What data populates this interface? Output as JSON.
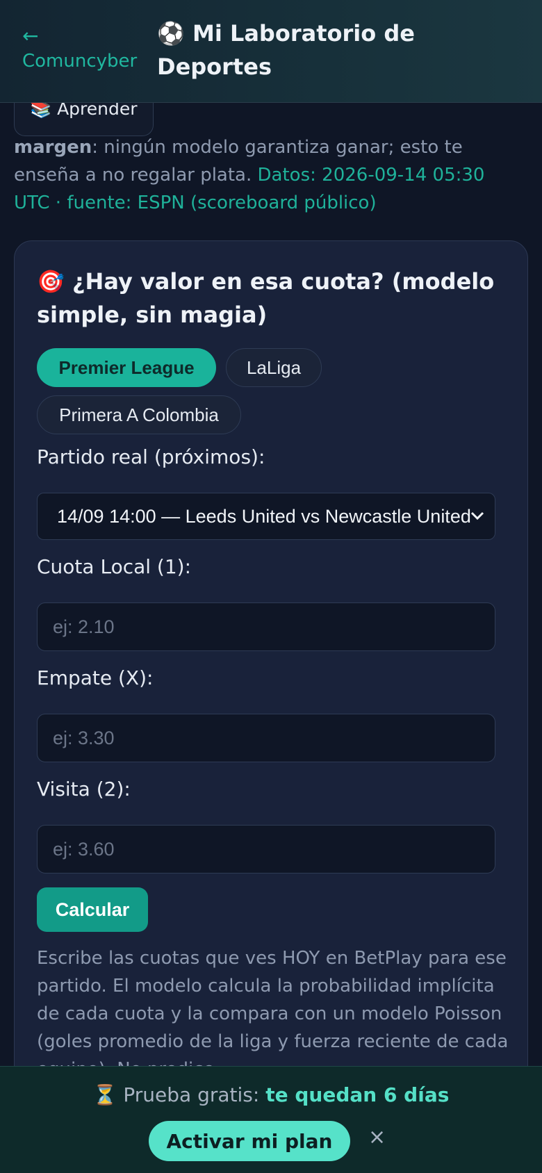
{
  "header": {
    "back_arrow": "←",
    "back_label": "Comuncyber",
    "title": "⚽ Mi Laboratorio de Deportes"
  },
  "learn_button": "📚 Aprender",
  "intro": {
    "bold": "margen",
    "text": ": ningún modelo garantiza ganar; esto te enseña a no regalar plata.",
    "data_source": "Datos: 2026-09-14 05:30 UTC · fuente: ESPN (scoreboard público)"
  },
  "card": {
    "title": "🎯 ¿Hay valor en esa cuota? (modelo simple, sin magia)",
    "leagues": [
      {
        "label": "Premier League",
        "active": true
      },
      {
        "label": "LaLiga",
        "active": false
      },
      {
        "label": "Primera A Colombia",
        "active": false
      }
    ],
    "match_label": "Partido real (próximos):",
    "match_selected": "14/09 14:00 — Leeds United vs Newcastle United",
    "home_label": "Cuota Local (1):",
    "home_placeholder": "ej: 2.10",
    "draw_label": "Empate (X):",
    "draw_placeholder": "ej: 3.30",
    "away_label": "Visita (2):",
    "away_placeholder": "ej: 3.60",
    "calc_button": "Calcular",
    "description": "Escribe las cuotas que ves HOY en BetPlay para ese partido. El modelo calcula la probabilidad implícita de cada cuota y la compara con un modelo Poisson (goles promedio de la liga y fuerza reciente de cada equipo). No predice"
  },
  "trial": {
    "icon": "⏳",
    "prefix": "Prueba gratis:",
    "strong": "te quedan 6 días",
    "activate": "Activar mi plan",
    "close": "×"
  },
  "colors": {
    "accent": "#1ab39b",
    "background": "#0f1626",
    "card": "#19223a",
    "trial_bar": "#0e2a2a"
  }
}
